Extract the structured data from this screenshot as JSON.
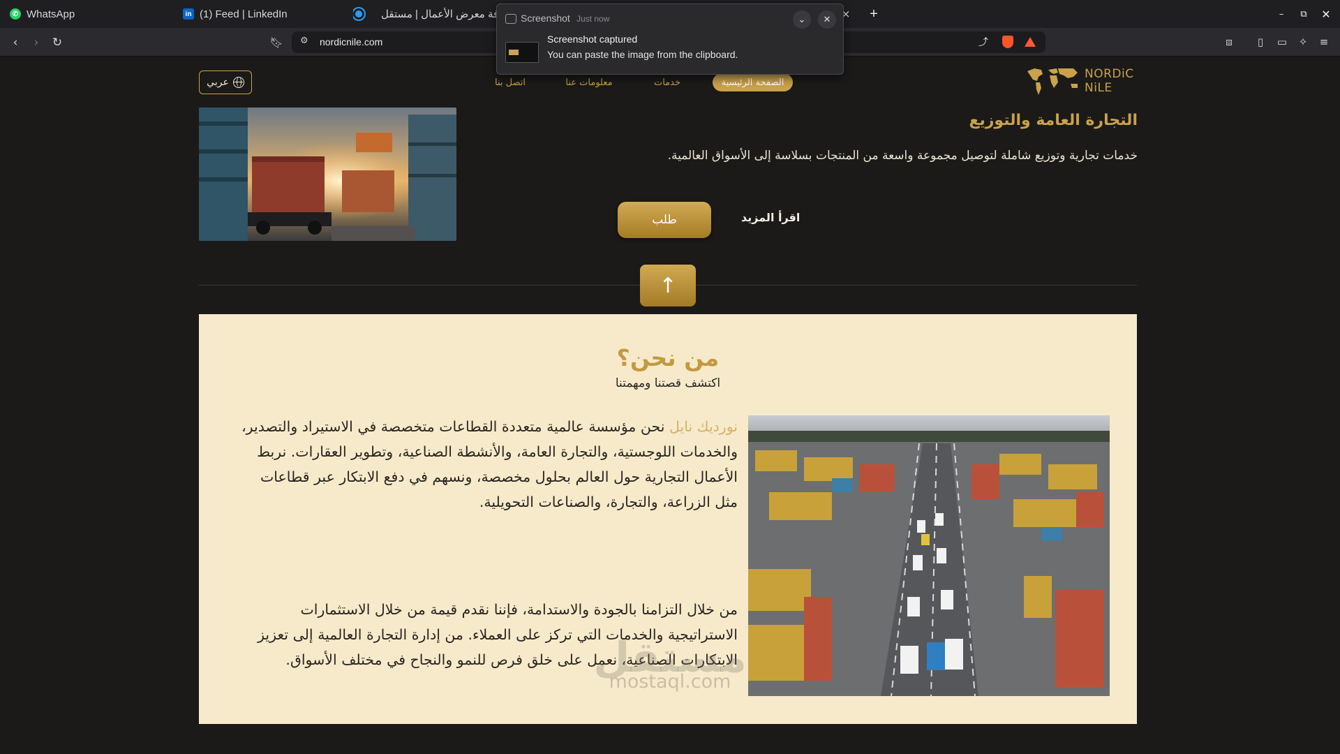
{
  "browser": {
    "tabs": [
      {
        "label": "WhatsApp",
        "icon": "whatsapp-icon"
      },
      {
        "label": "(1) Feed | LinkedIn",
        "icon": "linkedin-icon"
      },
      {
        "label": "افة معرض الأعمال | مستقل",
        "icon": "mostaql-icon"
      }
    ],
    "url": "nordicnile.com",
    "new_tab_symbol": "+",
    "close_symbol": "×"
  },
  "notification": {
    "app": "Screenshot",
    "time": "Just now",
    "title": "Screenshot captured",
    "body": "You can paste the image from the clipboard."
  },
  "site": {
    "logo_line1": "NORDiC",
    "logo_line2": "NiLE",
    "lang_label": "عربي",
    "nav": {
      "home": "الصفحة الرئيسية",
      "services": "خدمات",
      "about": "معلومات عنا",
      "contact": "اتصل بنا"
    },
    "hero": {
      "title": "التجارة العامة والتوزيع",
      "description": "خدمات تجارية وتوزيع شاملة لتوصيل مجموعة واسعة من المنتجات بسلاسة إلى الأسواق العالمية.",
      "request_label": "طلب",
      "read_more_label": "اقرأ المزيد"
    },
    "up_arrow": "↑",
    "about": {
      "title": "من نحن؟",
      "subtitle": "اكتشف قصتنا ومهمتنا",
      "brand": "نورديك نايل",
      "paragraph1_rest": " نحن مؤسسة عالمية متعددة القطاعات متخصصة في الاستيراد والتصدير، والخدمات اللوجستية، والتجارة العامة، والأنشطة الصناعية، وتطوير العقارات. نربط الأعمال التجارية حول العالم بحلول مخصصة، ونسهم في دفع الابتكار عبر قطاعات مثل الزراعة، والتجارة، والصناعات التحويلية.",
      "paragraph2": "من خلال التزامنا بالجودة والاستدامة، فإننا نقدم قيمة من خلال الاستثمارات الاستراتيجية والخدمات التي تركز على العملاء. من إدارة التجارة العالمية إلى تعزيز الابتكارات الصناعية، نعمل على خلق فرص للنمو والنجاح في مختلف الأسواق."
    },
    "watermark": {
      "arabic": "مستقل",
      "latin": "mostaql.com"
    }
  },
  "colors": {
    "accent": "#c9a24a",
    "page_bg": "#1b1a19",
    "about_bg": "#f6eacb"
  }
}
